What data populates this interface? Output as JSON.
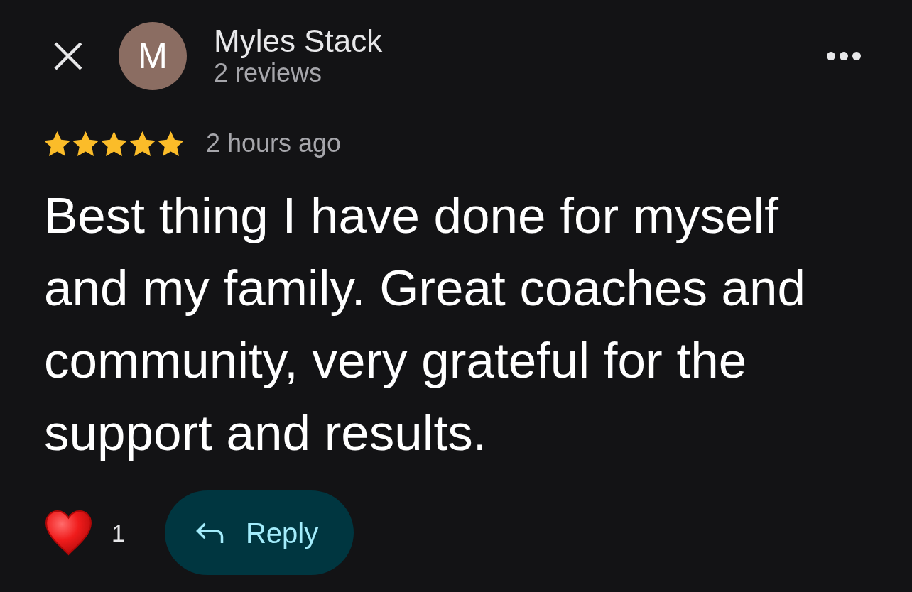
{
  "reviewer": {
    "initial": "M",
    "name": "Myles Stack",
    "review_count": "2 reviews"
  },
  "review": {
    "stars": 5,
    "time": "2 hours ago",
    "text": "Best thing I have done for myself and my family. Great coaches and community, very grateful for the support and results."
  },
  "actions": {
    "like_count": "1",
    "reply_button": "Reply"
  }
}
